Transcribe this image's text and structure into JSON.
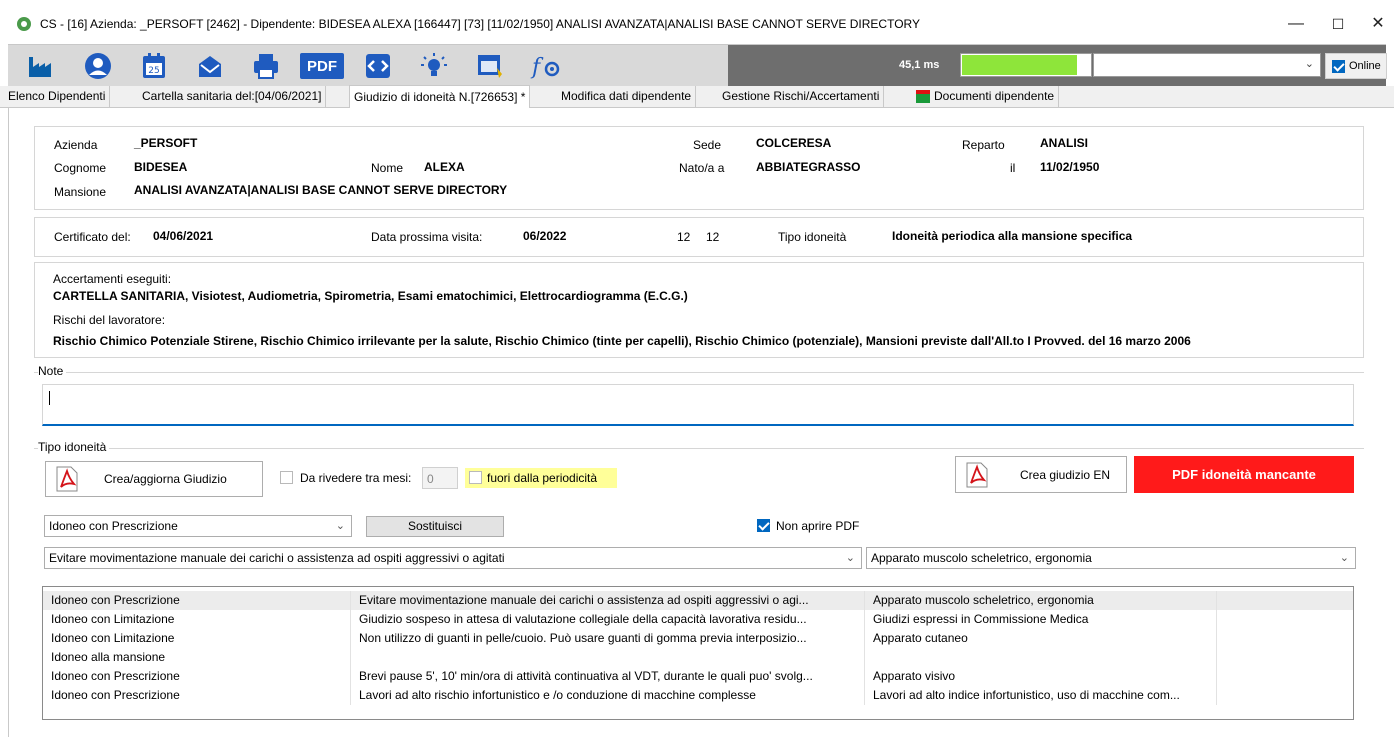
{
  "window": {
    "title": "CS - [16] Azienda: _PERSOFT [2462] - Dipendente: BIDESEA ALEXA [166447] [73] [11/02/1950] ANALISI AVANZATA|ANALISI BASE CANNOT SERVE DIRECTORY",
    "controls": {
      "minimize": "—",
      "maximize": "☐",
      "close": "✕"
    }
  },
  "toolbar": {
    "icons": [
      "factory-icon",
      "user-icon",
      "calendar-icon",
      "mail-icon",
      "printer-icon",
      "pdf-icon",
      "code-icon",
      "lightbulb-icon",
      "window-icon",
      "function-icon"
    ],
    "calendar_day": "25",
    "pdf_label": "PDF",
    "timing": "45,1 ms",
    "progress": 0.9,
    "combo_value": "",
    "online_label": "Online",
    "online_checked": true,
    "colors": {
      "brand": "#0067c0",
      "progress": "#8ee53a",
      "dark_strip": "#6e6e6e"
    }
  },
  "tabs": [
    {
      "label": "Elenco Dipendenti",
      "active": false
    },
    {
      "label": "Cartella sanitaria del:[04/06/2021]",
      "active": false
    },
    {
      "label": "Giudizio di idoneità N.[726653] *",
      "active": true
    },
    {
      "label": "Modifica dati dipendente",
      "active": false
    },
    {
      "label": "Gestione Rischi/Accertamenti",
      "active": false
    },
    {
      "label": "Documenti dipendente",
      "active": false
    }
  ],
  "header": {
    "azienda_label": "Azienda",
    "azienda": "_PERSOFT",
    "sede_label": "Sede",
    "sede": "COLCERESA",
    "reparto_label": "Reparto",
    "reparto": "ANALISI",
    "cognome_label": "Cognome",
    "cognome": "BIDESEA",
    "nome_label": "Nome",
    "nome": "ALEXA",
    "nato_label": "Nato/a a",
    "nato": "ABBIATEGRASSO",
    "il_label": "il",
    "data_nascita": "11/02/1950",
    "mansione_label": "Mansione",
    "mansione": "ANALISI AVANZATA|ANALISI BASE CANNOT SERVE DIRECTORY"
  },
  "certificato": {
    "cert_label": "Certificato del:",
    "cert_date": "04/06/2021",
    "prossima_label": "Data prossima visita:",
    "prossima": "06/2022",
    "n1": "12",
    "n2": "12",
    "tipo_label": "Tipo idoneità",
    "tipo": "Idoneità periodica alla mansione specifica"
  },
  "accertamenti": {
    "label": "Accertamenti eseguiti:",
    "value": "CARTELLA SANITARIA, Visiotest, Audiometria, Spirometria, Esami ematochimici, Elettrocardiogramma (E.C.G.)",
    "rischi_label": "Rischi del lavoratore:",
    "rischi": "Rischio Chimico Potenziale Stirene, Rischio Chimico irrilevante per la salute, Rischio Chimico (tinte per capelli), Rischio Chimico (potenziale), Mansioni previste dall'All.to I Provved. del 16 marzo 2006"
  },
  "note": {
    "label": "Note",
    "value": ""
  },
  "tipo_idoneita": {
    "group_label": "Tipo idoneità",
    "crea_button": "Crea/aggiorna Giudizio",
    "rivedere_label": "Da rivedere tra mesi:",
    "rivedere_value": "0",
    "fuori_label": "fuori dalla periodicità",
    "crea_en_button": "Crea giudizio EN",
    "pdf_mancante": "PDF idoneità mancante",
    "giudizio_select": "Idoneo con Prescrizione",
    "sostituisci_button": "Sostituisci",
    "non_aprire_label": "Non aprire PDF",
    "prescrizione_select": "Evitare movimentazione manuale dei carichi o assistenza ad ospiti aggressivi o agitati",
    "apparato_select": "Apparato muscolo scheletrico, ergonomia",
    "colors": {
      "alert": "#ff1a1a",
      "highlight": "#ffff99"
    }
  },
  "grid": {
    "rows": [
      [
        "Idoneo con Prescrizione",
        "Evitare movimentazione manuale dei carichi o assistenza ad ospiti aggressivi o agi...",
        "Apparato muscolo scheletrico, ergonomia"
      ],
      [
        "Idoneo con Limitazione",
        "Giudizio sospeso in attesa di valutazione collegiale della capacità lavorativa residu...",
        "Giudizi espressi in Commissione Medica"
      ],
      [
        "Idoneo con Limitazione",
        "Non utilizzo di guanti in pelle/cuoio. Può usare guanti di gomma previa interposizio...",
        "Apparato cutaneo"
      ],
      [
        "Idoneo alla mansione",
        "",
        ""
      ],
      [
        "Idoneo con Prescrizione",
        "Brevi pause 5', 10' min/ora di attività continuativa al VDT, durante le quali puo' svolg...",
        "Apparato visivo"
      ],
      [
        "Idoneo con Prescrizione",
        "Lavori ad alto rischio infortunistico e /o conduzione di macchine complesse",
        "Lavori ad alto indice infortunistico, uso di macchine com..."
      ]
    ]
  }
}
